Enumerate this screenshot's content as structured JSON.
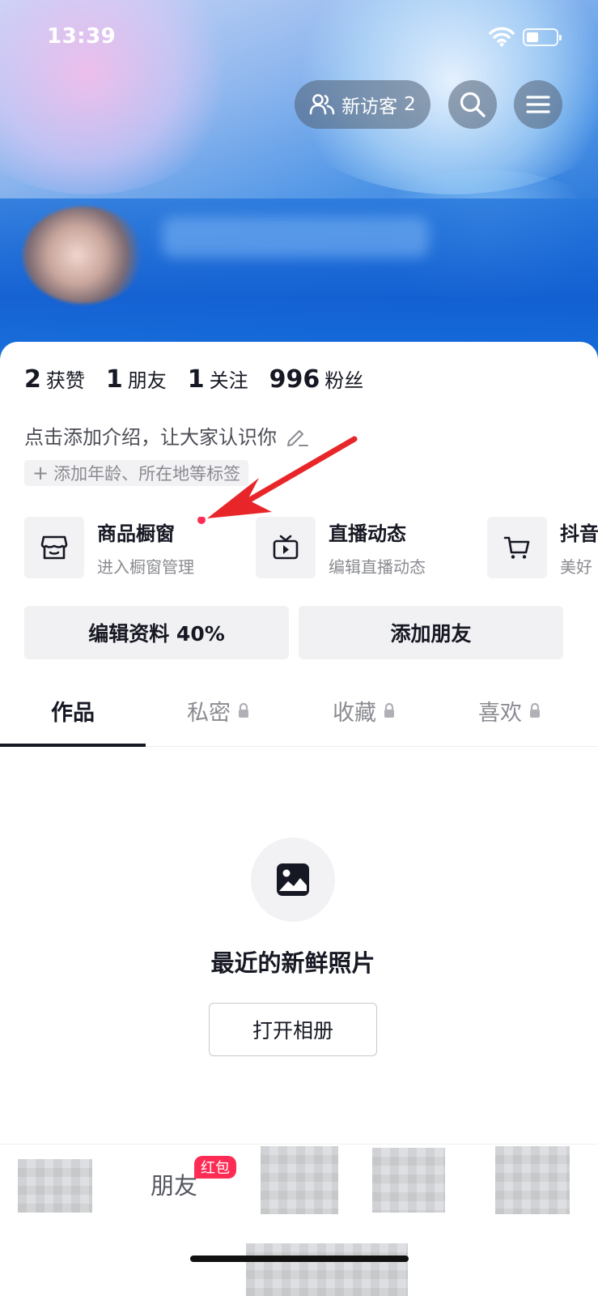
{
  "status_bar": {
    "time": "13:39"
  },
  "header": {
    "visitor_label": "新访客",
    "visitor_count": "2"
  },
  "stats": [
    {
      "num": "2",
      "label": "获赞"
    },
    {
      "num": "1",
      "label": "朋友"
    },
    {
      "num": "1",
      "label": "关注"
    },
    {
      "num": "996",
      "label": "粉丝"
    }
  ],
  "intro": {
    "text": "点击添加介绍，让大家认识你",
    "tag_add": "添加年龄、所在地等标签"
  },
  "services": [
    {
      "title": "商品橱窗",
      "subtitle": "进入橱窗管理",
      "icon": "store-icon"
    },
    {
      "title": "直播动态",
      "subtitle": "编辑直播动态",
      "icon": "tv-icon"
    },
    {
      "title": "抖音",
      "subtitle": "美好",
      "icon": "cart-icon"
    }
  ],
  "actions": {
    "edit_profile": "编辑资料 40%",
    "add_friends": "添加朋友"
  },
  "tabs": [
    {
      "label": "作品"
    },
    {
      "label": "私密"
    },
    {
      "label": "收藏"
    },
    {
      "label": "喜欢"
    }
  ],
  "empty_state": {
    "title": "最近的新鲜照片",
    "button": "打开相册"
  },
  "bottom_nav": {
    "friends": "朋友",
    "badge": "红包"
  },
  "colors": {
    "accent_red": "#fe2c55",
    "text": "#161823",
    "muted": "#8a8b91"
  }
}
